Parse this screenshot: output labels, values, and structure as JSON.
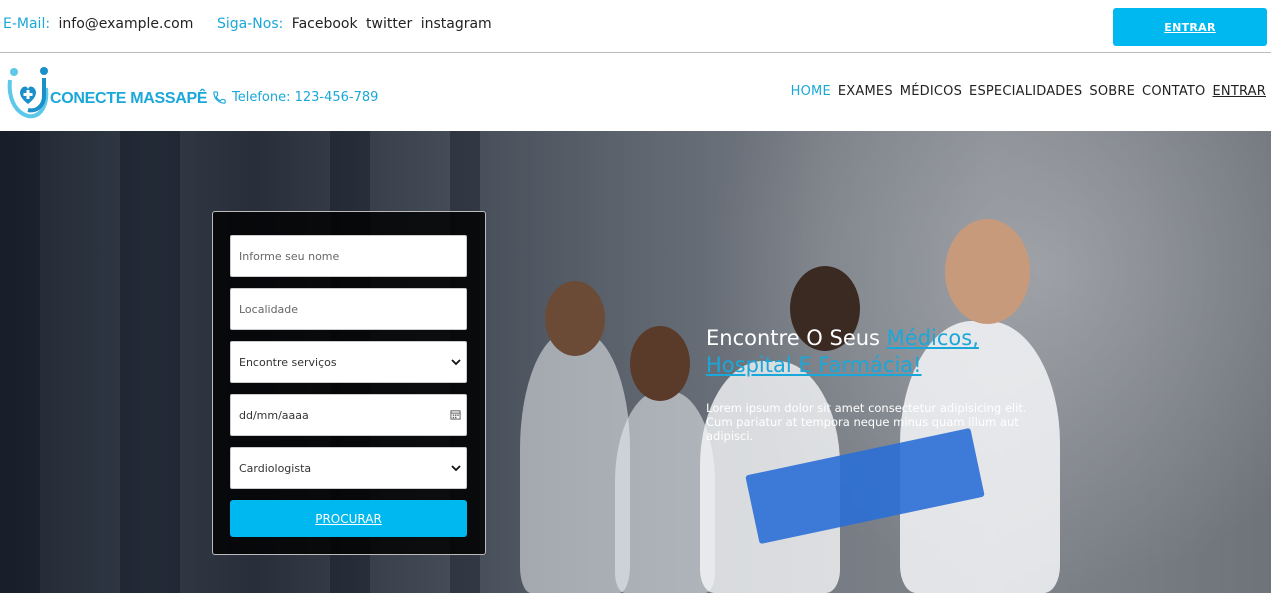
{
  "topbar": {
    "email_label": "E-Mail:",
    "email_value": "info@example.com",
    "social_label": "Siga-Nos:",
    "social_links": [
      "Facebook",
      "twitter",
      "instagram"
    ],
    "enter_button": "ENTRAR"
  },
  "navbar": {
    "logo_text": "CONECTE MASSAPÊ",
    "phone": "Telefone: 123-456-789",
    "menu": [
      "HOME",
      "EXAMES",
      "MÉDICOS",
      "ESPECIALIDADES",
      "SOBRE",
      "CONTATO",
      "ENTRAR"
    ]
  },
  "form": {
    "name_placeholder": "Informe seu nome",
    "location_placeholder": "Localidade",
    "service_selected": "Encontre serviços",
    "date_placeholder": "dd/mm/aaaa",
    "specialty_selected": "Cardiologista",
    "submit_label": "PROCURAR"
  },
  "hero": {
    "title_plain": "Encontre O Seus ",
    "title_highlight": "Médicos, Hospital E Farmácia!",
    "description": "Lorem ipsum dolor sit amet consectetur adipisicing elit. Cum pariatur at tempora neque minus quam illum aut adipisci."
  },
  "colors": {
    "accent": "#00b8f0",
    "accent_text": "#1aa7d9"
  }
}
